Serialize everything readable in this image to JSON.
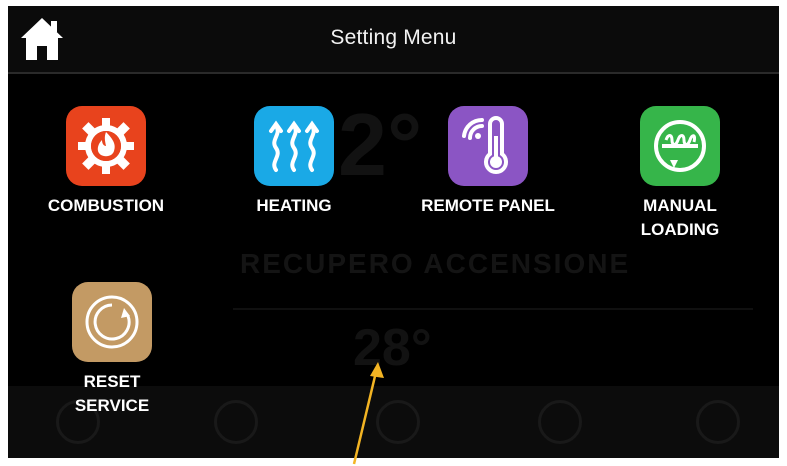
{
  "header": {
    "title": "Setting Menu",
    "home_icon": "home-icon"
  },
  "menu": [
    {
      "id": "combustion",
      "label": "COMBUSTION",
      "icon": "flame-gear-icon",
      "color": "#e8431d"
    },
    {
      "id": "heating",
      "label": "HEATING",
      "icon": "heat-waves-icon",
      "color": "#1aa9e6"
    },
    {
      "id": "remote_panel",
      "label": "REMOTE PANEL",
      "icon": "wireless-thermometer-icon",
      "color": "#8b55c4"
    },
    {
      "id": "manual_loading",
      "label_line1": "MANUAL",
      "label_line2": "LOADING",
      "icon": "auger-icon",
      "color": "#36b54a"
    },
    {
      "id": "reset_service",
      "label_line1": "RESET",
      "label_line2": "SERVICE",
      "icon": "reset-cycle-icon",
      "color": "#c39a64"
    }
  ],
  "background": {
    "main_temp": "2°",
    "status": "RECUPERO ACCENSIONE",
    "secondary_temp": "28°"
  },
  "annotation": {
    "arrow_color": "#f3b423"
  }
}
